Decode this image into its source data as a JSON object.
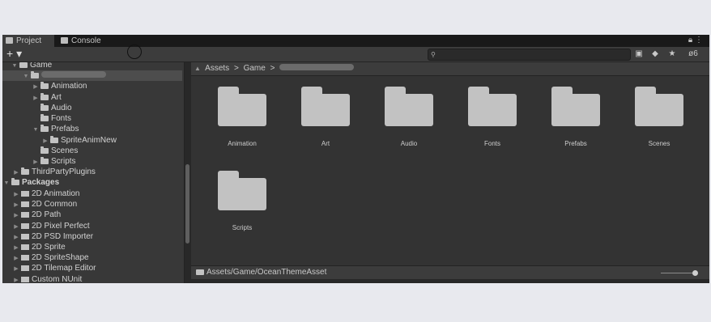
{
  "tabs": [
    {
      "label": "Project",
      "icon": "folder-icon"
    },
    {
      "label": "Console",
      "icon": "console-icon"
    }
  ],
  "window_menu": {
    "lock_icon": "lock-icon",
    "more_icon": "more-vertical-icon"
  },
  "toolbar": {
    "add_label": "+ ▾",
    "hidden_count": "6",
    "search_value": ""
  },
  "tree": {
    "rows": [
      {
        "label": "Game",
        "bold": false
      },
      {
        "label": "",
        "bold": false,
        "blurred": true
      },
      {
        "label": "Animation"
      },
      {
        "label": "Art"
      },
      {
        "label": "Audio"
      },
      {
        "label": "Fonts"
      },
      {
        "label": "Prefabs"
      },
      {
        "label": "SpriteAnimNew"
      },
      {
        "label": "Scenes"
      },
      {
        "label": "Scripts"
      },
      {
        "label": "ThirdPartyPlugins"
      },
      {
        "label": "Packages",
        "bold": true
      },
      {
        "label": "2D Animation"
      },
      {
        "label": "2D Common"
      },
      {
        "label": "2D Path"
      },
      {
        "label": "2D Pixel Perfect"
      },
      {
        "label": "2D PSD Importer"
      },
      {
        "label": "2D Sprite"
      },
      {
        "label": "2D SpriteShape"
      },
      {
        "label": "2D Tilemap Editor"
      },
      {
        "label": "Custom NUnit"
      }
    ]
  },
  "breadcrumb": {
    "items": [
      "Assets",
      "Game"
    ],
    "separator": ">"
  },
  "folders": [
    "Animation",
    "Art",
    "Audio",
    "Fonts",
    "Prefabs",
    "Scenes",
    "Scripts"
  ],
  "status": {
    "path": "Assets/Game/OceanThemeAsset",
    "zoom": 1.0
  },
  "colors": {
    "panel": "#282828",
    "tree_bg": "#383838",
    "grid_bg": "#333333",
    "folder": "#c2c2c2"
  }
}
